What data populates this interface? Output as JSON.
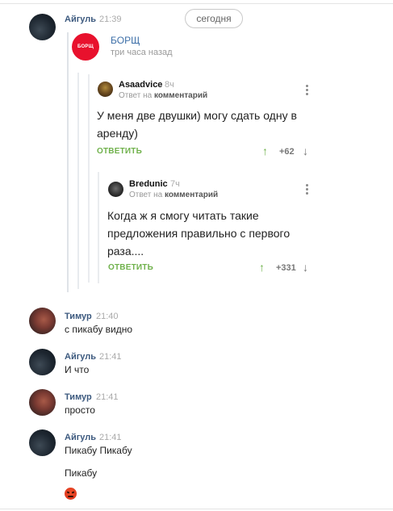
{
  "date_divider": "сегодня",
  "messages": [
    {
      "author": "Айгуль",
      "time": "21:39"
    },
    {
      "author": "Тимур",
      "time": "21:40",
      "text": "с пикабу видно"
    },
    {
      "author": "Айгуль",
      "time": "21:41",
      "text": "И что"
    },
    {
      "author": "Тимур",
      "time": "21:41",
      "text": "просто"
    },
    {
      "author": "Айгуль",
      "time": "21:41",
      "text": "Пикабу Пикабу",
      "text2": "Пикабу",
      "emoji": "angry-face-emoji"
    }
  ],
  "shared_post": {
    "logo_text": "БОРЩ",
    "source": "БОРЩ",
    "subtitle": "три часа назад"
  },
  "comments": [
    {
      "author": "Asaadvice",
      "time": "8ч",
      "reply_prefix": "Ответ на",
      "reply_target": "комментарий",
      "text_line1": "У меня две двушки) могу сдать одну в",
      "text_line2": "аренду)",
      "reply_label": "ОТВЕТИТЬ",
      "score": "+62"
    },
    {
      "author": "Bredunic",
      "time": "7ч",
      "reply_prefix": "Ответ на",
      "reply_target": "комментарий",
      "text_line1": "Когда ж я смогу читать такие",
      "text_line2": "предложения правильно с первого",
      "text_line3": "раза....",
      "reply_label": "ОТВЕТИТЬ",
      "score": "+331"
    }
  ],
  "colors": {
    "author_name": "#3d5a7f",
    "accent_green": "#6fb14b",
    "brand_red": "#e8112d"
  }
}
